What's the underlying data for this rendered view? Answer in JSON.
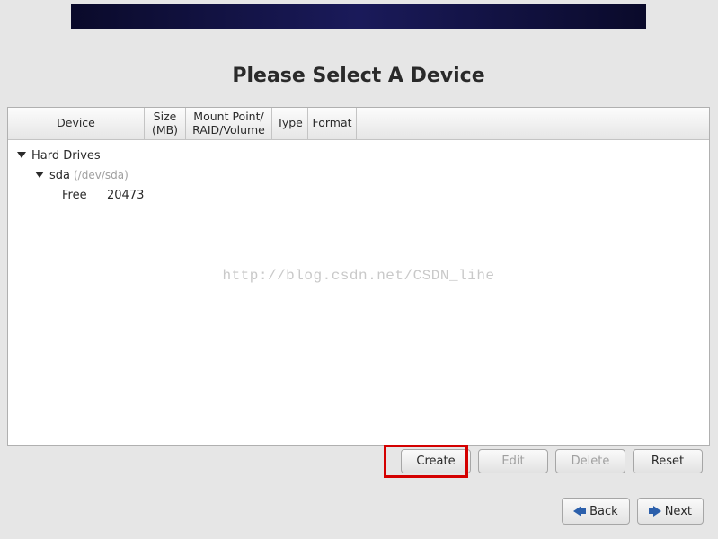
{
  "title": "Please Select A Device",
  "columns": {
    "device": "Device",
    "size": "Size (MB)",
    "mount": "Mount Point/ RAID/Volume",
    "type": "Type",
    "format": "Format"
  },
  "tree": {
    "hard_drives_label": "Hard Drives",
    "disk_label": "sda",
    "disk_path": "(/dev/sda)",
    "free_label": "Free",
    "free_size": "20473"
  },
  "watermark": "http://blog.csdn.net/CSDN_lihe",
  "buttons": {
    "create": "Create",
    "edit": "Edit",
    "delete": "Delete",
    "reset": "Reset",
    "back": "Back",
    "next": "Next"
  }
}
